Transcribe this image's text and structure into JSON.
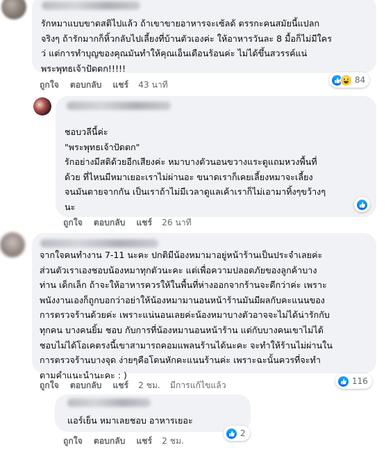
{
  "comments": [
    {
      "text": "รักหมาแบบขาดสติไปแล้ว ถ้าเขาขายอาหารจะเซ้ลด้ ตรรกะคนสมัยนี้แปลก\nจริงๆ ถ้ารักมากก็หิ้วกลับไปเลี้ยงที่บ้านตัวเองค่ะ ให้อาหารวันละ 8 มื้อก็ไม่มีใคร\nว่ แต่การทำบุญของคุณมันทำให้คุณเอ็นเดือนร้อนค่ะ ไม่ได้ขึ้นสวรรค์แน่\nพระพุทธเจ้าปัดตก!!!!!",
      "like": "ถูกใจ",
      "reply": "ตอบกลับ",
      "share": "แชร์",
      "time": "43 นาที",
      "reaction_count": "84"
    },
    {
      "text": "ชอบวลีนี้ค่ะ\n\"พระพุทธเจ้าปัดตก\"\nรักอย่างมีสติด้วยอีกเสียงค่ะ หมาบางตัวนอนขวางแระดูแถมหวงพื้นที่\nด้วย ที่ไหนมีหมาเยอะเราไม่ผ่านอะ ขนาดเราก็เคยเลี้ยงหมาจะเลี้ยง\nจนมันตายจากกัน เป็นเราถ้าไม่มีเวลาดูแลเค้าเราก็ไม่เอามาทิ้งๆขว้างๆ\nนะ",
      "like": "ถูกใจ",
      "reply": "ตอบกลับ",
      "share": "แชร์",
      "time": "26 นาที"
    },
    {
      "text": "จากใจคนทำงาน 7-11 นะคะ ปกติมีน้องหมามาอยู่หน้าร้านเป็นประจำเลยค่ะ\nส่วนตัวเราเองชอบน้องหมาทุกตัวนะคะ แต่เพื่อความปลอดภัยของลูกค้าบาง\nท่าน เด็กเล็ก ถ้าจะให้อาหารควรให้ในพื้นที่ห่างออกจากร้านจะดีกว่าค่ะ เพราะ\nพนังงานเองก็ถูกบอกว่าอย่าให้น้องหมามานอนหน้าร้านมันมีผลกับคะแนนของ\nการตรวจร้านด้วยค่ะ เพราะแน่นอนเลยค่ะน้องหมาบางตัวอาจจะไม่ได้น่ารักกับ\nทุกคน บางคนยิ้ม ชอบ กับการที่น้องหมานอนหน้าร้าน แต่กับบางคนเขาไม่ได้\nชอบไม่ได้โอเคตรงนี้เขาสามารถคอมแพลนร้านได้นะคะ จะทำให้ร้านไม่ผ่านใน\nการตรวจร้านบางจุด ง่ายๆคือโดนหักคะแนนร้านค่ะ เพราะฉะนั้นควรที่จะทำ\nตามคำแนะนำนะคะ : )",
      "like": "ถูกใจ",
      "reply": "ตอบกลับ",
      "share": "แชร์",
      "time": "2 ชม.",
      "edited": "มีการแก้ไขแล้ว",
      "reaction_count": "116"
    },
    {
      "text": "แอร์เย็น หมาเลยชอบ อาหารเยอะ",
      "like": "ถูกใจ",
      "reply": "ตอบกลับ",
      "share": "แชร์",
      "time": "2 ชม.",
      "reaction_count": "2"
    }
  ],
  "colors": {
    "bubble": "#f0f2f5",
    "meta_text": "#65676b",
    "like_blue": "#1877f2"
  }
}
